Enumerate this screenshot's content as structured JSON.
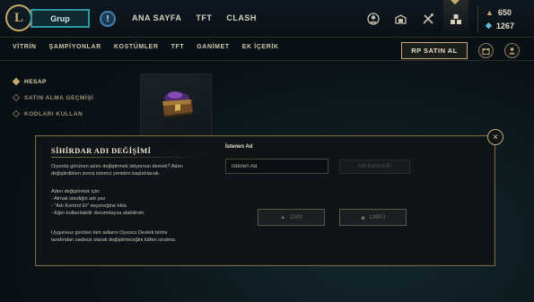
{
  "header": {
    "logo_letter": "L",
    "play_label": "Grup",
    "info_icon": "!",
    "nav": [
      "ANA SAYFA",
      "TFT",
      "CLASH"
    ],
    "icons": [
      "profile-icon",
      "collection-icon",
      "loot-icon",
      "store-icon"
    ],
    "currencies": [
      {
        "name": "rp-icon",
        "value": "650"
      },
      {
        "name": "blue-essence-icon",
        "value": "1267"
      }
    ]
  },
  "store_nav": {
    "items": [
      "VİTRİN",
      "ŞAMPİYONLAR",
      "KOSTÜMLER",
      "TFT",
      "GANİMET",
      "EK İÇERİK"
    ],
    "buy_rp_label": "RP SATIN AL"
  },
  "account_nav": {
    "items": [
      "HESAP",
      "SATIN ALMA GEÇMİŞİ",
      "KODLARI KULLAN"
    ],
    "active_index": 0
  },
  "modal": {
    "title": "SİHİRDAR ADI DEĞİŞİMİ",
    "p1_line1": "Oyunda görünen adını değiştirmek istiyorsun demek? Adını",
    "p1_line2": "değiştirdikten sonra istemci yeniden başlatılacak.",
    "p2_line1": "Adını değiştirmek için:",
    "p2_line2": "- Almak istediğin adı yaz",
    "p2_line3": "- \"Adı Kontrol Et\" seçeneğine tıkla",
    "p2_line4": "- Eğer kullanılabilir durumdaysa alabilirsin.",
    "p3_line1": "Uygunsuz görülen tüm adların Oyuncu Destek birimi",
    "p3_line2": "tarafından sadesiz olarak değiştirileceğini lütfen unutma.",
    "field_label": "İstenen Ad",
    "input_placeholder": "İstenen Ad",
    "input_value": "",
    "check_button": "Adı Kontrol Et",
    "price_rp": "1300",
    "price_be": "13900",
    "close_label": "×"
  }
}
